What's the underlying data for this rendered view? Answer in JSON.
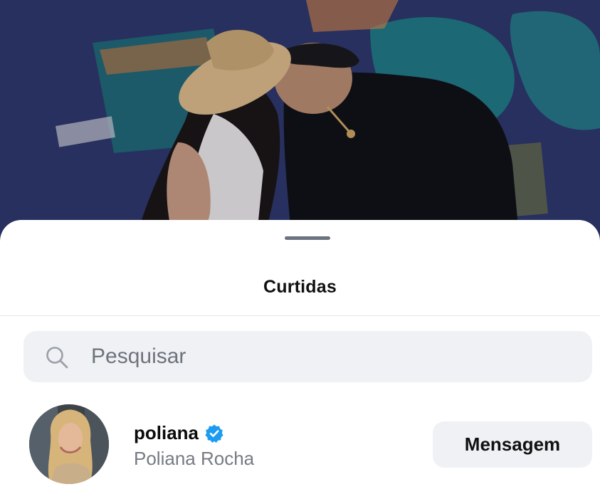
{
  "sheet": {
    "title": "Curtidas"
  },
  "search": {
    "placeholder": "Pesquisar",
    "icon": "search-icon"
  },
  "likes": [
    {
      "username": "poliana",
      "full_name": "Poliana Rocha",
      "verified": true,
      "button_label": "Mensagem"
    }
  ],
  "colors": {
    "verified_badge": "#1d9bf0",
    "sheet_background": "#ffffff",
    "field_background": "#eff1f5"
  }
}
